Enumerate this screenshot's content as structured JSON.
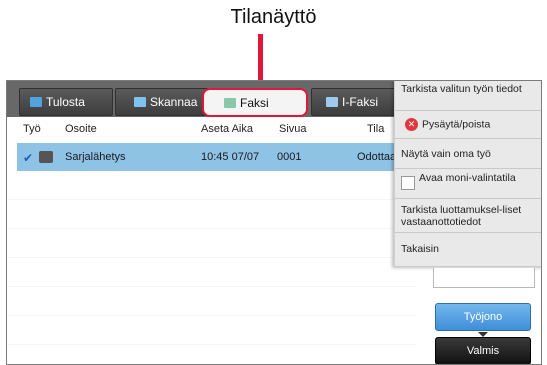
{
  "callout": {
    "label": "Tilanäyttö"
  },
  "tabs": [
    {
      "label": "Tulosta",
      "active": false,
      "icon": "print-icon"
    },
    {
      "label": "Skannaa",
      "active": false,
      "icon": "scan-icon"
    },
    {
      "label": "Faksi",
      "active": true,
      "icon": "fax-icon"
    },
    {
      "label": "I-Faksi",
      "active": false,
      "icon": "ifax-icon"
    }
  ],
  "columns": {
    "job": "Työ",
    "address": "Osoite",
    "set_time": "Aseta Aika",
    "pages": "Sivua",
    "status": "Tila"
  },
  "jobs": [
    {
      "address": "Sarjalähetys",
      "time": "10:45 07/07",
      "pages": "0001",
      "status": "Odottaa",
      "selected": true
    }
  ],
  "menu": {
    "items": [
      {
        "label": "Tarkista valitun työn tiedot"
      },
      {
        "label": "Pysäytä/poista",
        "icon": "stop-icon"
      },
      {
        "label": "Näytä vain oma työ"
      },
      {
        "label": "Avaa moni-valintatila",
        "checkbox": true
      },
      {
        "label": "Tarkista luottamuksel-liset vastaanottotiedot"
      },
      {
        "label": "Takaisin"
      }
    ]
  },
  "buttons": {
    "queue": "Työjono",
    "done": "Valmis"
  },
  "colors": {
    "accent_red": "#e0173a",
    "selected_row": "#8fc3e6",
    "primary_blue": "#3f8ed8"
  }
}
